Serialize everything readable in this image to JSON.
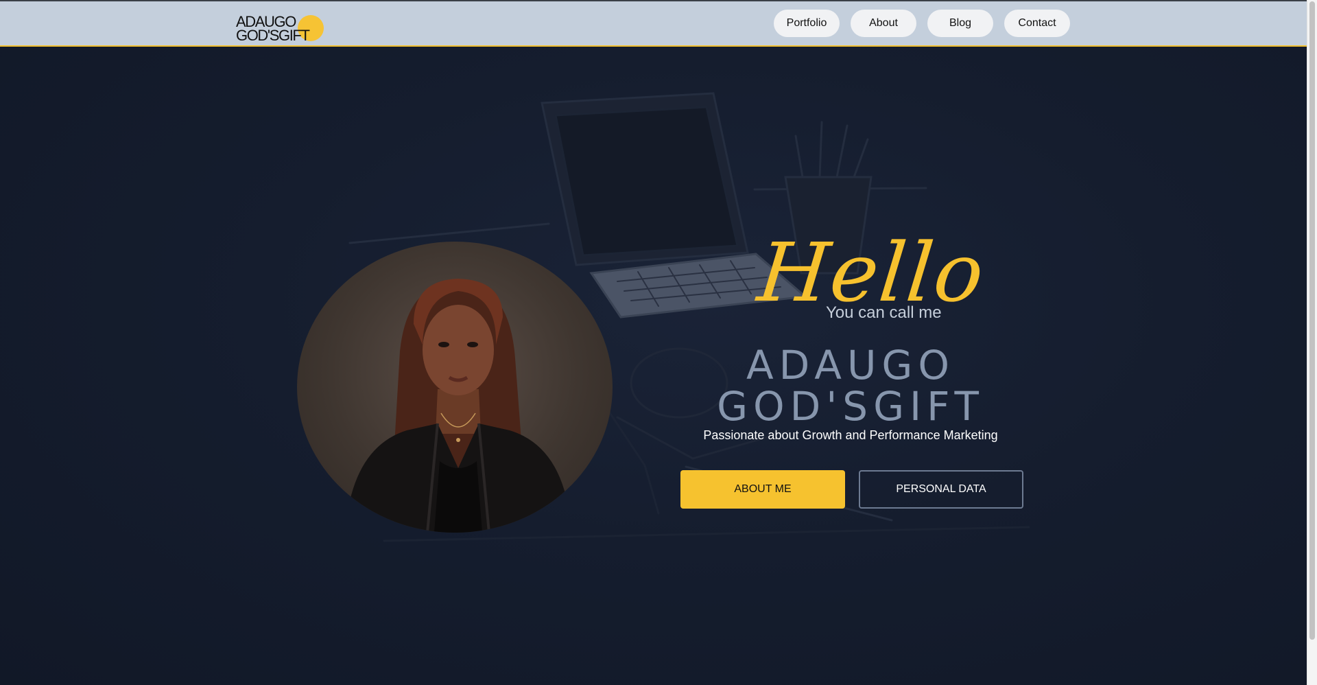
{
  "header": {
    "logo": {
      "line1": "ADAUGO",
      "line2": "GOD'SGIFT"
    },
    "nav": [
      {
        "label": "Portfolio"
      },
      {
        "label": "About"
      },
      {
        "label": "Blog"
      },
      {
        "label": "Contact"
      }
    ]
  },
  "hero": {
    "greeting": "Hello",
    "greeting_sub": "You can call me",
    "name_line1": "ADAUGO",
    "name_line2": "GOD'SGIFT",
    "tagline": "Passionate about Growth and Performance Marketing",
    "primary_button": "ABOUT ME",
    "secondary_button": "PERSONAL DATA"
  },
  "colors": {
    "accent": "#f6c22f",
    "nav_background": "#c4cfdc",
    "hero_background": "#131b2b",
    "name_text": "#8796ad"
  }
}
